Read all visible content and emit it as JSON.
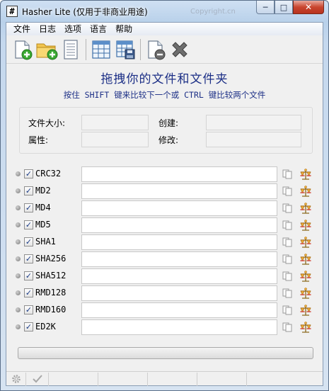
{
  "window": {
    "title": "Hasher Lite (仅用于非商业用途)",
    "watermark": "Copyright.cn",
    "app_icon_glyph": "#",
    "minimize_glyph": "─",
    "maximize_glyph": "□",
    "close_glyph": "✕"
  },
  "menu": [
    "文件",
    "日志",
    "选项",
    "语言",
    "帮助"
  ],
  "toolbar": {
    "buttons": [
      "add-file-icon",
      "add-folder-icon",
      "document-icon",
      "table-icon",
      "save-table-icon",
      "remove-file-icon",
      "clear-icon"
    ]
  },
  "header": {
    "title": "拖拽你的文件和文件夹",
    "hint": "按住 SHIFT 键来比较下一个或 CTRL 键比较两个文件"
  },
  "info": {
    "size_label": "文件大小:",
    "attr_label": "属性:",
    "created_label": "创建:",
    "modified_label": "修改:",
    "size_value": "",
    "attr_value": "",
    "created_value": "",
    "modified_value": ""
  },
  "hashes": [
    {
      "name": "CRC32",
      "checked": true,
      "value": ""
    },
    {
      "name": "MD2",
      "checked": true,
      "value": ""
    },
    {
      "name": "MD4",
      "checked": true,
      "value": ""
    },
    {
      "name": "MD5",
      "checked": true,
      "value": ""
    },
    {
      "name": "SHA1",
      "checked": true,
      "value": ""
    },
    {
      "name": "SHA256",
      "checked": true,
      "value": ""
    },
    {
      "name": "SHA512",
      "checked": true,
      "value": ""
    },
    {
      "name": "RMD128",
      "checked": true,
      "value": ""
    },
    {
      "name": "RMD160",
      "checked": true,
      "value": ""
    },
    {
      "name": "ED2K",
      "checked": true,
      "value": ""
    }
  ],
  "checkmark_glyph": "✓",
  "progress": {
    "value": 0
  },
  "colors": {
    "header_text": "#1c2f86",
    "close_button": "#c9452f"
  }
}
